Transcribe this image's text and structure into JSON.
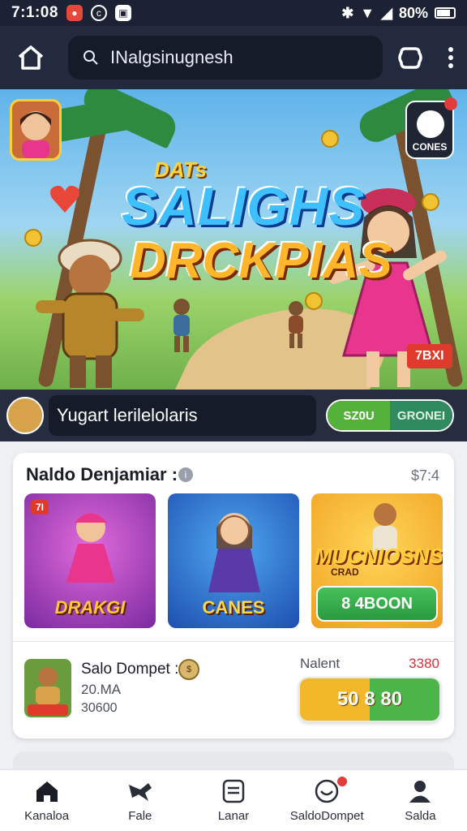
{
  "status_bar": {
    "time": "7:1:08",
    "battery": "80%"
  },
  "topbar": {
    "search_text": "INalgsinugnesh"
  },
  "hero": {
    "small_title": "DATs",
    "title_line1": "SALIGHS",
    "title_line2": "DRCKPIAS",
    "corner_badge": "CONES",
    "tag": "7BXI"
  },
  "promo_strip": {
    "label": "Yugart lerilelolaris",
    "pill_left": "SZ0U",
    "pill_right": "GRONEI"
  },
  "card": {
    "title": "Naldo Denjamiar :",
    "price": "$7:4",
    "tiles": [
      {
        "label": "DRAKGI",
        "badge": "7I"
      },
      {
        "label": "CANES"
      },
      {
        "title": "MUCNIOSNS",
        "subtitle": "CRAD",
        "button": "8 4BOON"
      }
    ],
    "row": {
      "title": "Salo Dompet :",
      "coin_text": "$",
      "sub1": "20.MA",
      "sub2": "30600",
      "right_label": "Nalent",
      "right_value": "3380",
      "button": "50 8 80"
    }
  },
  "bottom_nav": [
    {
      "label": "Kanaloa",
      "icon": "home-icon"
    },
    {
      "label": "Fale",
      "icon": "bird-icon"
    },
    {
      "label": "Lanar",
      "icon": "list-icon"
    },
    {
      "label": "SaldoDompet",
      "icon": "wallet-smile-icon"
    },
    {
      "label": "Salda",
      "icon": "user-icon"
    }
  ],
  "colors": {
    "dark_bar": "#232a3d",
    "accent_green": "#4bb54a",
    "accent_gold": "#f3b72a",
    "alert_red": "#e23b3b"
  }
}
